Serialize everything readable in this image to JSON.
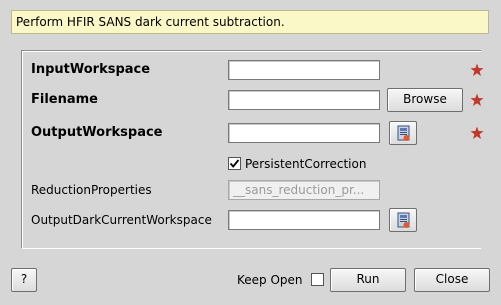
{
  "description": "Perform HFIR SANS dark current subtraction.",
  "properties": {
    "input_workspace": {
      "label": "InputWorkspace",
      "value": ""
    },
    "filename": {
      "label": "Filename",
      "value": "",
      "browse_label": "Browse"
    },
    "output_workspace": {
      "label": "OutputWorkspace",
      "value": ""
    },
    "persistent_correction": {
      "label": "PersistentCorrection",
      "checked": true
    },
    "reduction_properties": {
      "label": "ReductionProperties",
      "value": "__sans_reduction_pr..."
    },
    "output_dark_current_workspace": {
      "label": "OutputDarkCurrentWorkspace",
      "value": ""
    }
  },
  "footer": {
    "help_label": "?",
    "keep_open_label": "Keep Open",
    "keep_open_checked": false,
    "run_label": "Run",
    "close_label": "Close"
  },
  "colors": {
    "required_star": "#c0392b",
    "description_bg": "#fbf8c8",
    "window_bg": "#d6d6d6"
  }
}
